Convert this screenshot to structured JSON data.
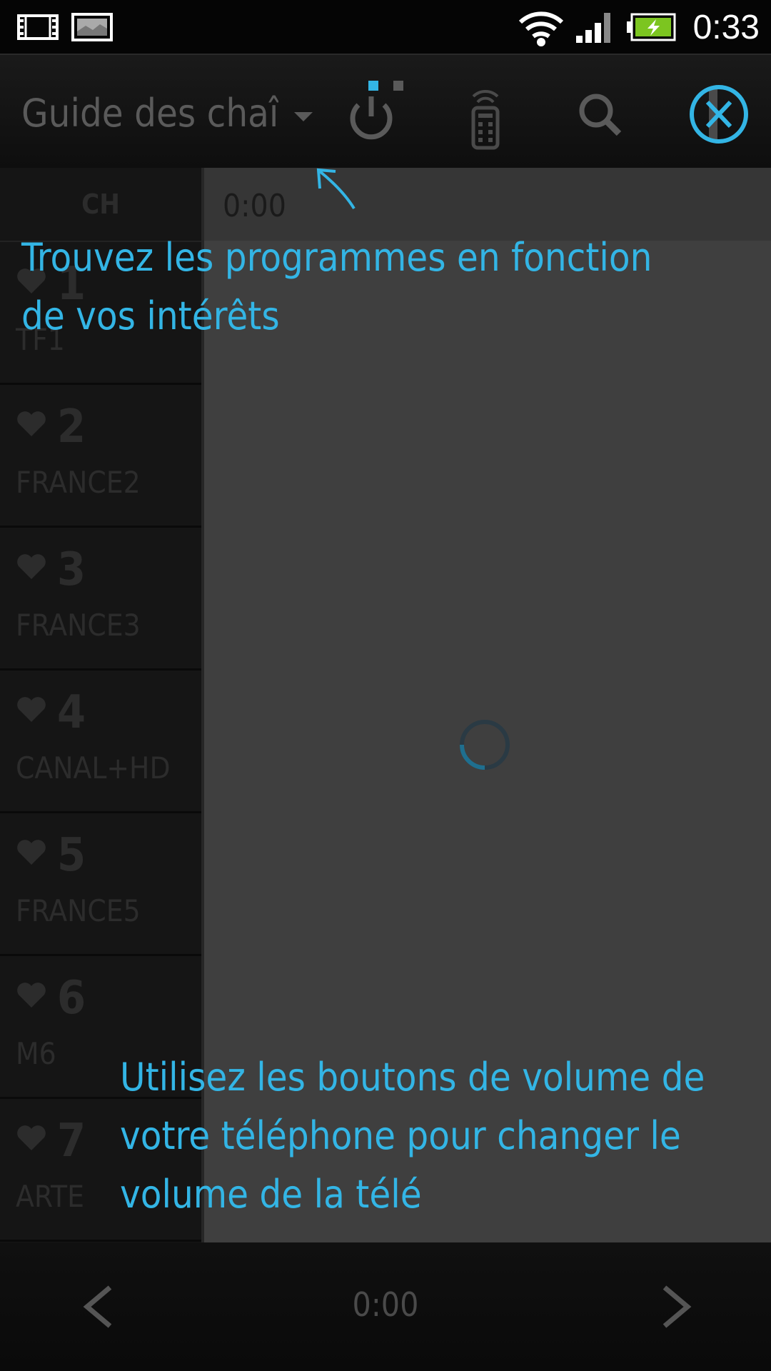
{
  "status_bar": {
    "time": "0:33",
    "icons": [
      "video-notification-icon",
      "image-notification-icon",
      "wifi-icon",
      "signal-icon",
      "battery-charging-icon"
    ]
  },
  "action_bar": {
    "title": "Guide des chaînes",
    "buttons": [
      "power-icon",
      "remote-icon",
      "search-icon",
      "close-icon"
    ]
  },
  "channel_list": {
    "header": "CH",
    "channels": [
      {
        "number": "1",
        "name": "TF1"
      },
      {
        "number": "2",
        "name": "FRANCE2"
      },
      {
        "number": "3",
        "name": "FRANCE3"
      },
      {
        "number": "4",
        "name": "CANAL+HD"
      },
      {
        "number": "5",
        "name": "FRANCE5"
      },
      {
        "number": "6",
        "name": "M6"
      },
      {
        "number": "7",
        "name": "ARTE"
      }
    ]
  },
  "grid": {
    "time_header": "0:00"
  },
  "bottom_bar": {
    "time": "0:00"
  },
  "tips": {
    "top": "Trouvez les programmes en fonction de vos intérêts",
    "bottom": "Utilisez les boutons de volume de votre téléphone pour changer le volume de la télé"
  },
  "colors": {
    "accent": "#33b5e5",
    "battery": "#7cc520"
  }
}
